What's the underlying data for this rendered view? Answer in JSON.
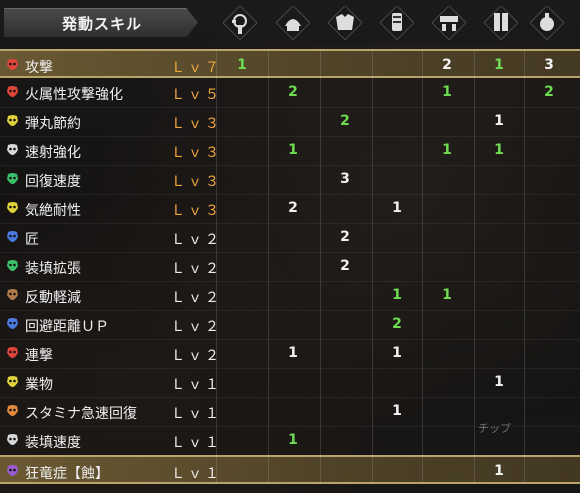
{
  "header": {
    "title": "発動スキル",
    "columns": [
      {
        "icon": "weapon-icon"
      },
      {
        "icon": "head-armor-icon"
      },
      {
        "icon": "chest-armor-icon"
      },
      {
        "icon": "arm-armor-icon"
      },
      {
        "icon": "waist-armor-icon"
      },
      {
        "icon": "leg-armor-icon"
      },
      {
        "icon": "charm-icon"
      }
    ]
  },
  "colors": {
    "icon_red": "#e0453a",
    "icon_orange": "#e08a3a",
    "icon_yellow": "#e0d23a",
    "icon_white": "#d8d8d8",
    "icon_green": "#3ac06a",
    "icon_blue": "#4a7ae0",
    "icon_brown": "#b07a4a",
    "icon_purple": "#9a5ad0",
    "level_orange": "#f0a640",
    "value_green": "#6fdc52",
    "highlight_gold": "#b8a36a"
  },
  "skills": [
    {
      "name": "攻撃",
      "level": "Ｌｖ７",
      "level_color": "#f0a640",
      "icon_color": "#e0453a",
      "highlight": true,
      "values": [
        "1",
        "",
        "",
        "",
        "2",
        "1",
        "3"
      ],
      "value_colors": [
        "green",
        "",
        "",
        "",
        "white",
        "green",
        "white"
      ]
    },
    {
      "name": "火属性攻撃強化",
      "level": "Ｌｖ５",
      "level_color": "#f0a640",
      "icon_color": "#e0453a",
      "highlight": false,
      "values": [
        "",
        "2",
        "",
        "",
        "1",
        "",
        "2"
      ],
      "value_colors": [
        "",
        "green",
        "",
        "",
        "green",
        "",
        "green"
      ]
    },
    {
      "name": "弾丸節約",
      "level": "Ｌｖ３",
      "level_color": "#f0a640",
      "icon_color": "#e0d23a",
      "highlight": false,
      "values": [
        "",
        "",
        "2",
        "",
        "",
        "1",
        ""
      ],
      "value_colors": [
        "",
        "",
        "green",
        "",
        "",
        "white",
        ""
      ]
    },
    {
      "name": "速射強化",
      "level": "Ｌｖ３",
      "level_color": "#f0a640",
      "icon_color": "#d8d8d8",
      "highlight": false,
      "values": [
        "",
        "1",
        "",
        "",
        "1",
        "1",
        ""
      ],
      "value_colors": [
        "",
        "green",
        "",
        "",
        "green",
        "green",
        ""
      ]
    },
    {
      "name": "回復速度",
      "level": "Ｌｖ３",
      "level_color": "#f0a640",
      "icon_color": "#3ac06a",
      "highlight": false,
      "values": [
        "",
        "",
        "3",
        "",
        "",
        "",
        ""
      ],
      "value_colors": [
        "",
        "",
        "white",
        "",
        "",
        "",
        ""
      ]
    },
    {
      "name": "気絶耐性",
      "level": "Ｌｖ３",
      "level_color": "#f0a640",
      "icon_color": "#e0d23a",
      "highlight": false,
      "values": [
        "",
        "2",
        "",
        "1",
        "",
        "",
        ""
      ],
      "value_colors": [
        "",
        "white",
        "",
        "white",
        "",
        "",
        ""
      ]
    },
    {
      "name": "匠",
      "level": "Ｌｖ２",
      "level_color": "#ececec",
      "icon_color": "#4a7ae0",
      "highlight": false,
      "values": [
        "",
        "",
        "2",
        "",
        "",
        "",
        ""
      ],
      "value_colors": [
        "",
        "",
        "white",
        "",
        "",
        "",
        ""
      ]
    },
    {
      "name": "装填拡張",
      "level": "Ｌｖ２",
      "level_color": "#ececec",
      "icon_color": "#3ac06a",
      "highlight": false,
      "values": [
        "",
        "",
        "2",
        "",
        "",
        "",
        ""
      ],
      "value_colors": [
        "",
        "",
        "white",
        "",
        "",
        "",
        ""
      ]
    },
    {
      "name": "反動軽減",
      "level": "Ｌｖ２",
      "level_color": "#ececec",
      "icon_color": "#b07a4a",
      "highlight": false,
      "values": [
        "",
        "",
        "",
        "1",
        "1",
        "",
        ""
      ],
      "value_colors": [
        "",
        "",
        "",
        "green",
        "green",
        "",
        ""
      ]
    },
    {
      "name": "回避距離ＵＰ",
      "level": "Ｌｖ２",
      "level_color": "#ececec",
      "icon_color": "#4a7ae0",
      "highlight": false,
      "values": [
        "",
        "",
        "",
        "2",
        "",
        "",
        ""
      ],
      "value_colors": [
        "",
        "",
        "",
        "green",
        "",
        "",
        ""
      ]
    },
    {
      "name": "連撃",
      "level": "Ｌｖ２",
      "level_color": "#ececec",
      "icon_color": "#e0453a",
      "highlight": false,
      "values": [
        "",
        "1",
        "",
        "1",
        "",
        "",
        ""
      ],
      "value_colors": [
        "",
        "white",
        "",
        "white",
        "",
        "",
        ""
      ]
    },
    {
      "name": "業物",
      "level": "Ｌｖ１",
      "level_color": "#ececec",
      "icon_color": "#e0d23a",
      "highlight": false,
      "values": [
        "",
        "",
        "",
        "",
        "",
        "1",
        ""
      ],
      "value_colors": [
        "",
        "",
        "",
        "",
        "",
        "white",
        ""
      ]
    },
    {
      "name": "スタミナ急速回復",
      "level": "Ｌｖ１",
      "level_color": "#ececec",
      "icon_color": "#e08a3a",
      "highlight": false,
      "values": [
        "",
        "",
        "",
        "1",
        "",
        "",
        ""
      ],
      "value_colors": [
        "",
        "",
        "",
        "white",
        "",
        "",
        ""
      ]
    },
    {
      "name": "装填速度",
      "level": "Ｌｖ１",
      "level_color": "#ececec",
      "icon_color": "#d8d8d8",
      "highlight": false,
      "values": [
        "",
        "1",
        "",
        "",
        "",
        "",
        ""
      ],
      "value_colors": [
        "",
        "green",
        "",
        "",
        "",
        "",
        ""
      ]
    },
    {
      "name": "狂竜症【蝕】",
      "level": "Ｌｖ１",
      "level_color": "#ececec",
      "icon_color": "#9a5ad0",
      "highlight": true,
      "values": [
        "",
        "",
        "",
        "",
        "",
        "1",
        ""
      ],
      "value_colors": [
        "",
        "",
        "",
        "",
        "",
        "white",
        ""
      ]
    }
  ],
  "overlay": {
    "text": "チップ"
  }
}
